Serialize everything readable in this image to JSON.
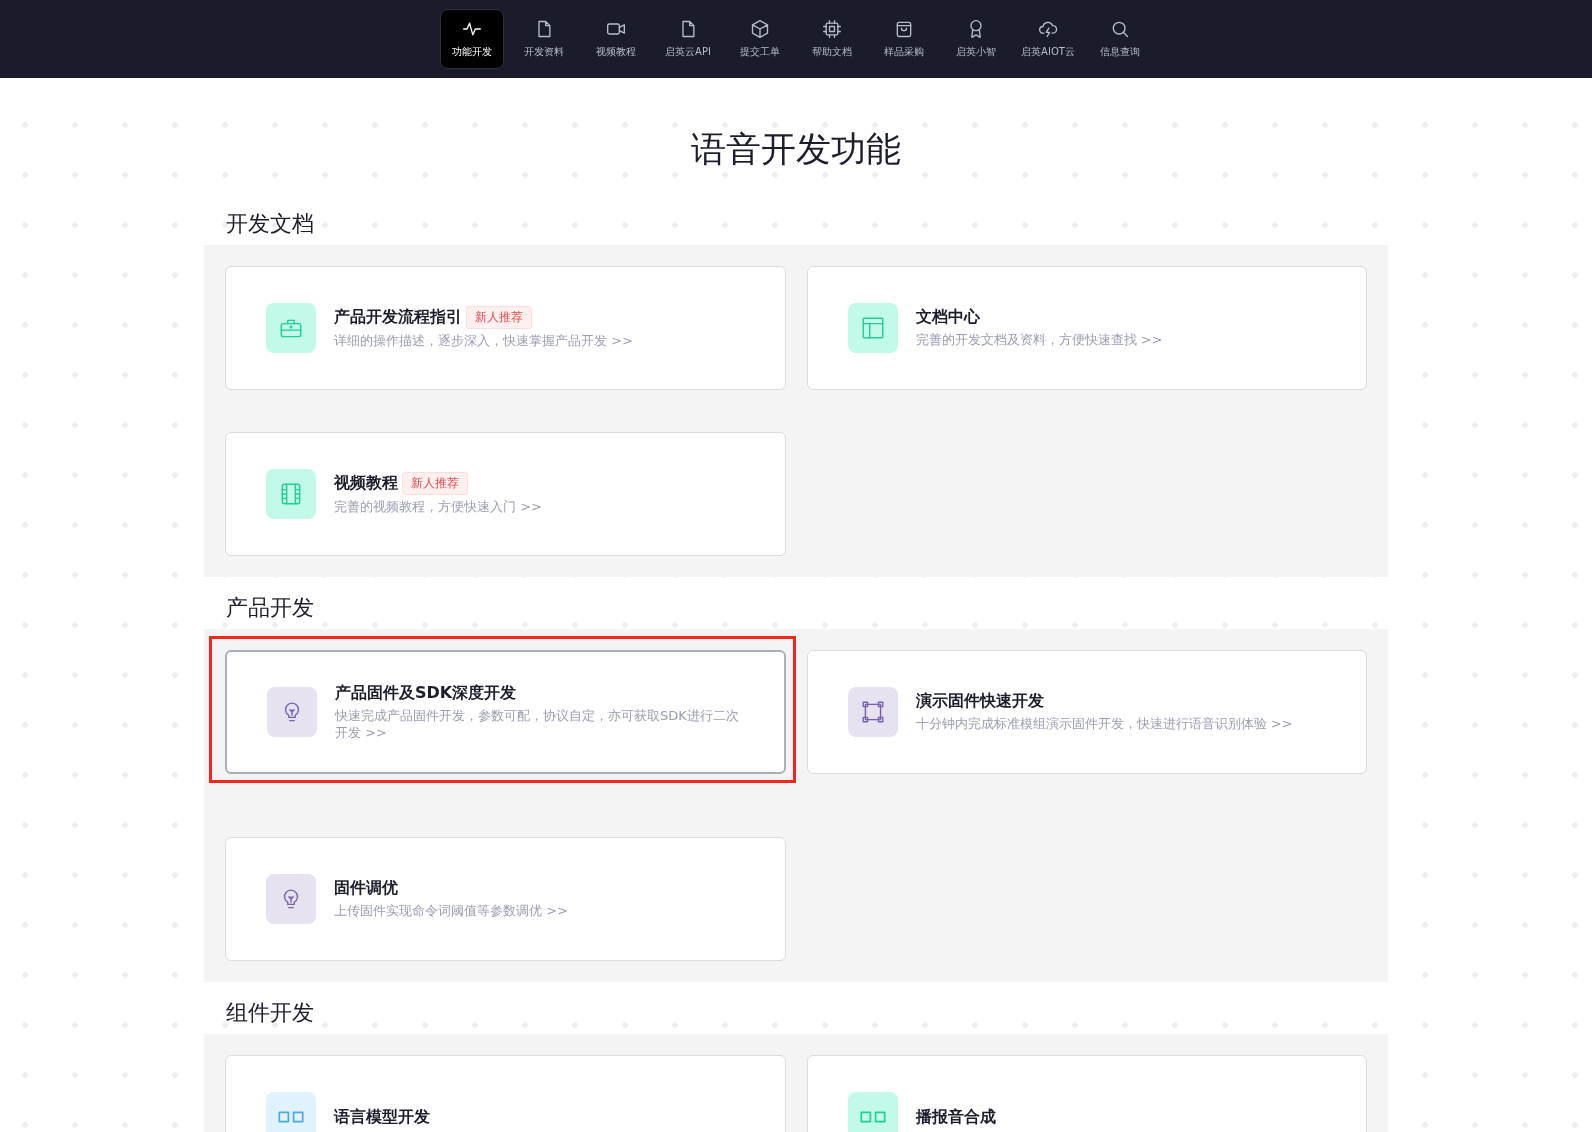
{
  "nav": [
    {
      "label": "功能开发",
      "kind": "pulse",
      "selected": true
    },
    {
      "label": "开发资料",
      "kind": "file",
      "selected": false
    },
    {
      "label": "视频教程",
      "kind": "video",
      "selected": false
    },
    {
      "label": "启英云API",
      "kind": "file",
      "selected": false
    },
    {
      "label": "提交工单",
      "kind": "cube",
      "selected": false
    },
    {
      "label": "帮助文档",
      "kind": "chip",
      "selected": false
    },
    {
      "label": "样品采购",
      "kind": "bag",
      "selected": false
    },
    {
      "label": "启英小智",
      "kind": "award",
      "selected": false
    },
    {
      "label": "启英AIOT云",
      "kind": "cloud",
      "selected": false
    },
    {
      "label": "信息查询",
      "kind": "search",
      "selected": false
    }
  ],
  "page_title": "语音开发功能",
  "sections": [
    {
      "title": "开发文档",
      "cards": [
        {
          "title": "产品开发流程指引",
          "badge": "新人推荐",
          "description": "详细的操作描述，逐步深入，快速掌握产品开发 >>",
          "kind": "briefcase",
          "color": "#c2f9e8",
          "highlighted": false
        },
        {
          "title": "文档中心",
          "description": "完善的开发文档及资料，方便快速查找 >>",
          "kind": "layout",
          "color": "#c2f9e8",
          "highlighted": false
        },
        {
          "title": "视频教程",
          "badge": "新人推荐",
          "description": "完善的视频教程，方便快速入门 >>",
          "kind": "film",
          "color": "#c2f9e8",
          "highlighted": false
        }
      ]
    },
    {
      "title": "产品开发",
      "cards": [
        {
          "title": "产品固件及SDK深度开发",
          "description": "快速完成产品固件开发，参数可配，协议自定，亦可获取SDK进行二次开发 >>",
          "kind": "bulb",
          "color": "#e6e2f0",
          "highlighted": true
        },
        {
          "title": "演示固件快速开发",
          "description": "十分钟内完成标准模组演示固件开发，快速进行语音识别体验 >>",
          "kind": "frame",
          "color": "#e6e2f0",
          "highlighted": false
        },
        {
          "title": "固件调优",
          "description": "上传固件实现命令词阈值等参数调优 >>",
          "kind": "bulb",
          "color": "#e6e2f0",
          "highlighted": false
        }
      ]
    },
    {
      "title": "组件开发",
      "cards": [
        {
          "title": "语言模型开发",
          "kind": "grid",
          "color": "#e0f2fe",
          "highlighted": false
        },
        {
          "title": "播报音合成",
          "kind": "grid",
          "color": "#c2f9e8",
          "highlighted": false
        }
      ]
    }
  ]
}
